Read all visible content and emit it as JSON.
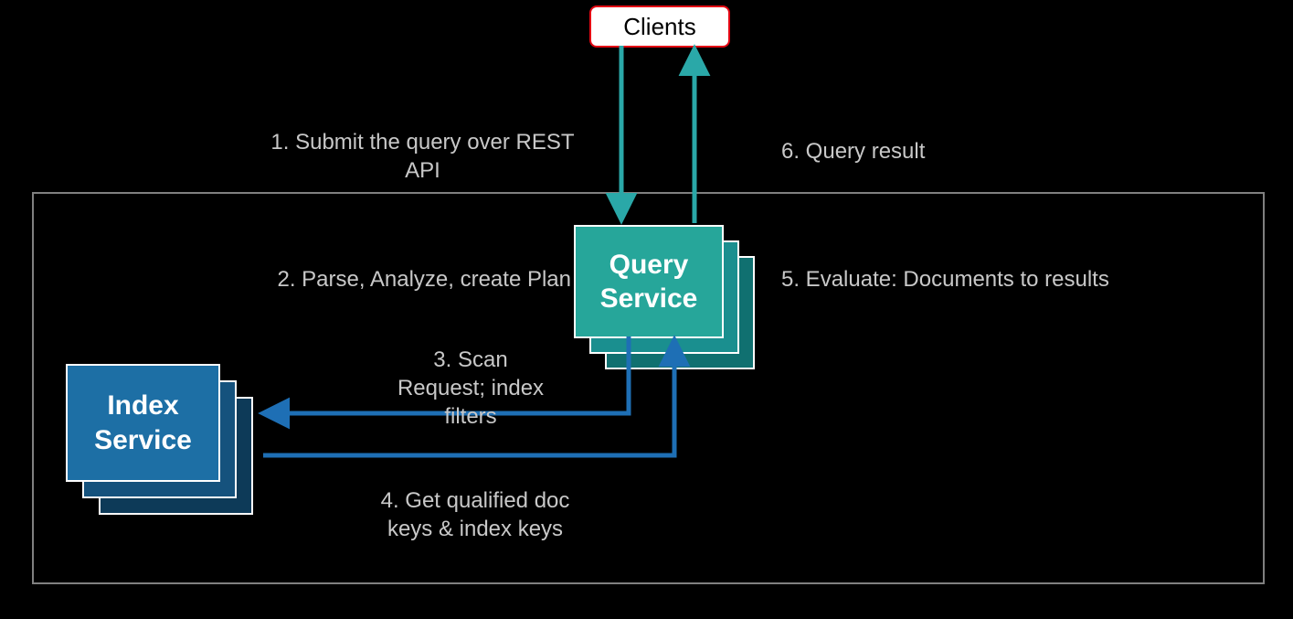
{
  "boxes": {
    "clients": "Clients",
    "query_service": "Query\nService",
    "index_service": "Index\nService"
  },
  "steps": {
    "s1": "1. Submit the query over REST\nAPI",
    "s2": "2. Parse, Analyze, create Plan",
    "s3": "3.  Scan\nRequest; index\nfilters",
    "s4": "4. Get qualified doc\nkeys & index keys",
    "s5": "5. Evaluate: Documents to results",
    "s6": "6. Query result"
  },
  "colors": {
    "teal": "#2AA8A8",
    "teal_fill": "#26A69A",
    "blue": "#1D6FA5",
    "blue_line": "#1E6FB5",
    "gray_frame": "#808080",
    "red": "#E30613"
  }
}
